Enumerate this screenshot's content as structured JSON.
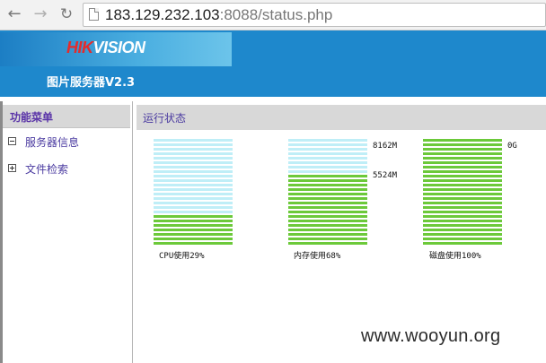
{
  "browser": {
    "url_host": "183.129.232.103",
    "url_rest": ":8088/status.php",
    "back_icon": "back-arrow-icon",
    "forward_icon": "forward-arrow-icon",
    "reload_icon": "reload-icon"
  },
  "header": {
    "logo_red": "HIK",
    "logo_white": "VISION",
    "title": "图片服务器V2.3"
  },
  "sidebar": {
    "heading": "功能菜单",
    "items": [
      {
        "label": "服务器信息",
        "state": "expanded"
      },
      {
        "label": "文件检索",
        "state": "collapsed"
      }
    ]
  },
  "main": {
    "section_title": "运行状态"
  },
  "gauges": [
    {
      "label": "CPU使用29%",
      "used_percent": 29,
      "marks": []
    },
    {
      "label": "内存使用68%",
      "used_percent": 68,
      "marks": [
        "8162M",
        "5524M"
      ]
    },
    {
      "label": "磁盘使用100%",
      "used_percent": 100,
      "marks": [
        "0G"
      ]
    }
  ],
  "colors": {
    "used": "#6cc93a",
    "free": "#bfeef7",
    "header": "#1e88cc",
    "logo_red": "#e52b2b"
  },
  "watermark": "www.wooyun.org"
}
